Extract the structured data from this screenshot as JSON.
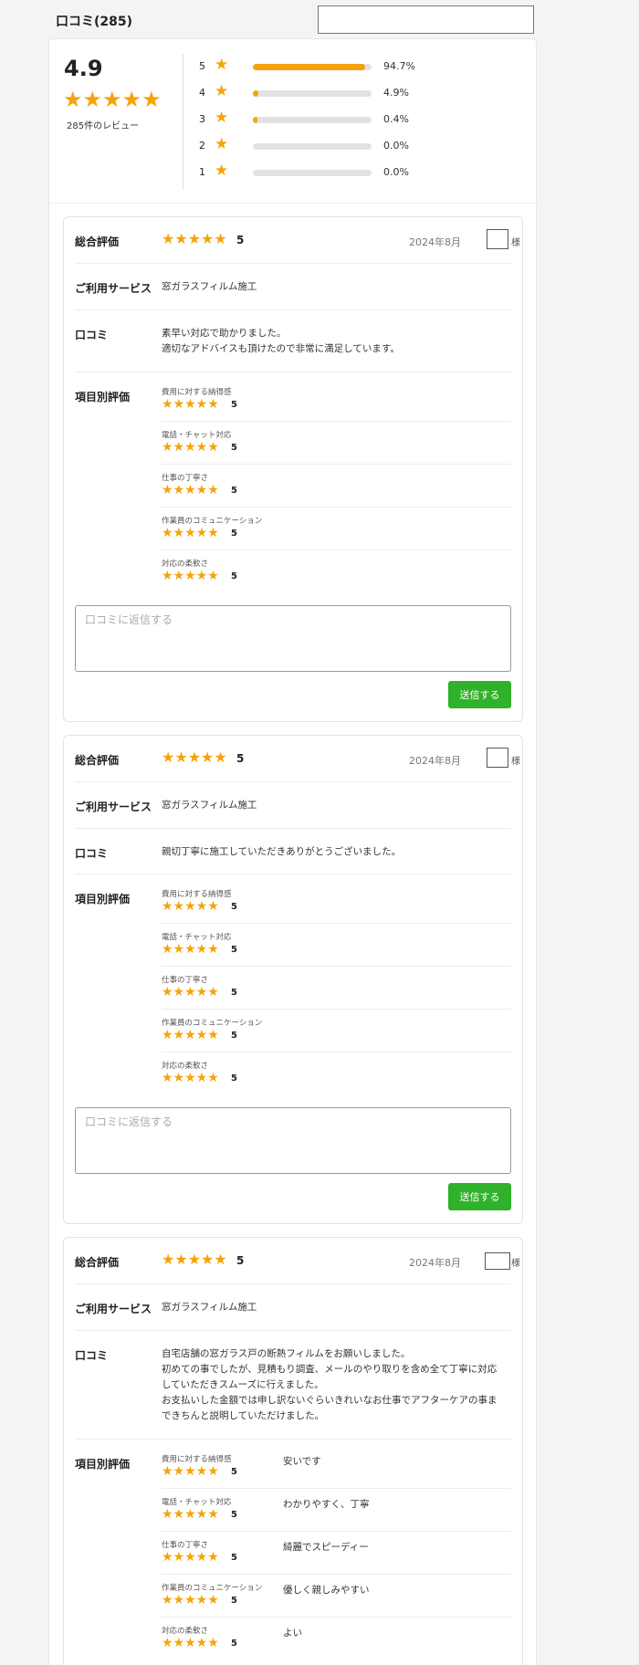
{
  "header": {
    "title": "口コミ(285)"
  },
  "summary": {
    "average": "4.9",
    "average_stars": "★★★★★",
    "count_label": "285件のレビュー",
    "distribution": [
      {
        "stars": "5",
        "pct": "94.7%",
        "fraction": 0.947
      },
      {
        "stars": "4",
        "pct": "4.9%",
        "fraction": 0.049
      },
      {
        "stars": "3",
        "pct": "0.4%",
        "fraction": 0.004
      },
      {
        "stars": "2",
        "pct": "0.0%",
        "fraction": 0.0
      },
      {
        "stars": "1",
        "pct": "0.0%",
        "fraction": 0.0
      }
    ]
  },
  "labels": {
    "overall": "総合評価",
    "service": "ご利用サービス",
    "comment": "口コミ",
    "items": "項目別評価",
    "sama": "様",
    "reply_placeholder": "口コミに返信する",
    "send": "送信する",
    "star_glyph": "★",
    "stars5": "★★★★★"
  },
  "reviews": [
    {
      "score": "5",
      "date": "2024年8月",
      "service": "窓ガラスフィルム施工",
      "comment_lines": [
        "素早い対応で助かりました。",
        "適切なアドバイスも頂けたので非常に満足しています。"
      ],
      "items": [
        {
          "label": "費用に対する納得感",
          "score": "5",
          "comment": ""
        },
        {
          "label": "電話・チャット対応",
          "score": "5",
          "comment": ""
        },
        {
          "label": "仕事の丁寧さ",
          "score": "5",
          "comment": ""
        },
        {
          "label": "作業員のコミュニケーション",
          "score": "5",
          "comment": ""
        },
        {
          "label": "対応の柔軟さ",
          "score": "5",
          "comment": ""
        }
      ]
    },
    {
      "score": "5",
      "date": "2024年8月",
      "service": "窓ガラスフィルム施工",
      "comment_lines": [
        "親切丁寧に施工していただきありがとうございました。"
      ],
      "items": [
        {
          "label": "費用に対する納得感",
          "score": "5",
          "comment": ""
        },
        {
          "label": "電話・チャット対応",
          "score": "5",
          "comment": ""
        },
        {
          "label": "仕事の丁寧さ",
          "score": "5",
          "comment": ""
        },
        {
          "label": "作業員のコミュニケーション",
          "score": "5",
          "comment": ""
        },
        {
          "label": "対応の柔軟さ",
          "score": "5",
          "comment": ""
        }
      ]
    },
    {
      "score": "5",
      "date": "2024年8月",
      "service": "窓ガラスフィルム施工",
      "comment_lines": [
        "自宅店舗の窓ガラス戸の断熱フィルムをお願いしました。",
        "初めての事でしたが、見積もり調査、メールのやり取りを含め全て丁寧に対応",
        "していただきスムーズに行えました。",
        "お支払いした金額では申し訳ないぐらいきれいなお仕事でアフターケアの事ま",
        "できちんと説明していただけました。"
      ],
      "items": [
        {
          "label": "費用に対する納得感",
          "score": "5",
          "comment": "安いです"
        },
        {
          "label": "電話・チャット対応",
          "score": "5",
          "comment": "わかりやすく、丁寧"
        },
        {
          "label": "仕事の丁寧さ",
          "score": "5",
          "comment": "綺麗でスピーディー"
        },
        {
          "label": "作業員のコミュニケーション",
          "score": "5",
          "comment": "優しく親しみやすい"
        },
        {
          "label": "対応の柔軟さ",
          "score": "5",
          "comment": "よい"
        }
      ]
    }
  ]
}
